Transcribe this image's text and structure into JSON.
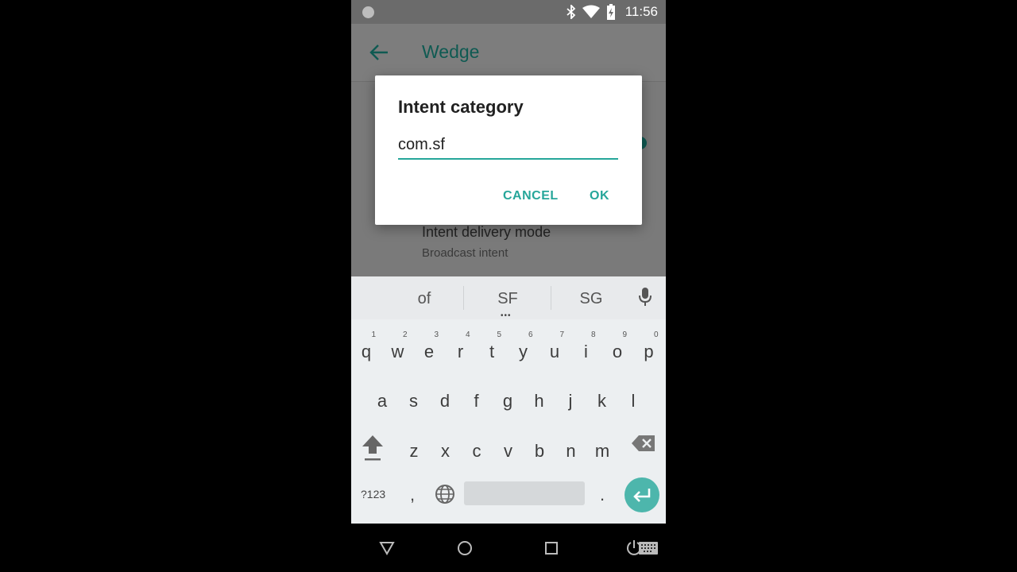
{
  "status_bar": {
    "time": "11:56",
    "icons": [
      "bluetooth-icon",
      "wifi-icon",
      "battery-charging-icon"
    ]
  },
  "app_bar": {
    "title": "Wedge",
    "back_icon": "arrow-left-icon"
  },
  "background_setting": {
    "title": "Intent delivery mode",
    "subtitle": "Broadcast intent"
  },
  "dialog": {
    "title": "Intent category",
    "input_value": "com.sf",
    "cancel_label": "CANCEL",
    "ok_label": "OK"
  },
  "keyboard": {
    "suggestions": [
      "of",
      "SF",
      "SG"
    ],
    "row1": [
      {
        "key": "q",
        "hint": "1"
      },
      {
        "key": "w",
        "hint": "2"
      },
      {
        "key": "e",
        "hint": "3"
      },
      {
        "key": "r",
        "hint": "4"
      },
      {
        "key": "t",
        "hint": "5"
      },
      {
        "key": "y",
        "hint": "6"
      },
      {
        "key": "u",
        "hint": "7"
      },
      {
        "key": "i",
        "hint": "8"
      },
      {
        "key": "o",
        "hint": "9"
      },
      {
        "key": "p",
        "hint": "0"
      }
    ],
    "row2": [
      "a",
      "s",
      "d",
      "f",
      "g",
      "h",
      "j",
      "k",
      "l"
    ],
    "row3": [
      "z",
      "x",
      "c",
      "v",
      "b",
      "n",
      "m"
    ],
    "symbols_label": "?123",
    "comma_label": ",",
    "period_label": ".",
    "accent_color": "#4db6ac"
  },
  "nav_bar": {
    "icons": [
      "back-triangle-icon",
      "home-circle-icon",
      "recents-square-icon",
      "keyboard-switch-icon"
    ]
  }
}
